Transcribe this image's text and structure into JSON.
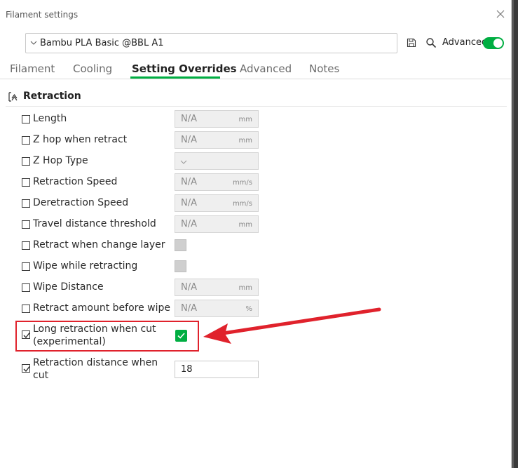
{
  "window": {
    "title": "Filament settings"
  },
  "preset": {
    "selected": "Bambu PLA Basic @BBL A1"
  },
  "toolbar": {
    "advanced_label": "Advanced",
    "advanced_on": true
  },
  "tabs": [
    {
      "label": "Filament"
    },
    {
      "label": "Cooling"
    },
    {
      "label": "Setting Overrides"
    },
    {
      "label": "Advanced"
    },
    {
      "label": "Notes"
    }
  ],
  "active_tab": "Setting Overrides",
  "section": {
    "title": "Retraction"
  },
  "options": [
    {
      "label": "Length",
      "checked": false,
      "value": "N/A",
      "unit": "mm"
    },
    {
      "label": "Z hop when retract",
      "checked": false,
      "value": "N/A",
      "unit": "mm"
    },
    {
      "label": "Z Hop Type",
      "checked": false,
      "value": ""
    },
    {
      "label": "Retraction Speed",
      "checked": false,
      "value": "N/A",
      "unit": "mm/s"
    },
    {
      "label": "Deretraction Speed",
      "checked": false,
      "value": "N/A",
      "unit": "mm/s"
    },
    {
      "label": "Travel distance threshold",
      "checked": false,
      "value": "N/A",
      "unit": "mm"
    },
    {
      "label": "Retract when change layer",
      "checked": false
    },
    {
      "label": "Wipe while retracting",
      "checked": false
    },
    {
      "label": "Wipe Distance",
      "checked": false,
      "value": "N/A",
      "unit": "mm"
    },
    {
      "label": "Retract amount before wipe",
      "checked": false,
      "value": "N/A",
      "unit": "%"
    },
    {
      "label_line1": "Long retraction when cut",
      "label_line2": "(experimental)",
      "checked": true,
      "enabled": true
    },
    {
      "label_line1": "Retraction distance when",
      "label_line2": "cut",
      "checked": true,
      "value": "18"
    }
  ],
  "colors": {
    "accent": "#00ae42",
    "highlight": "#e0222c"
  }
}
